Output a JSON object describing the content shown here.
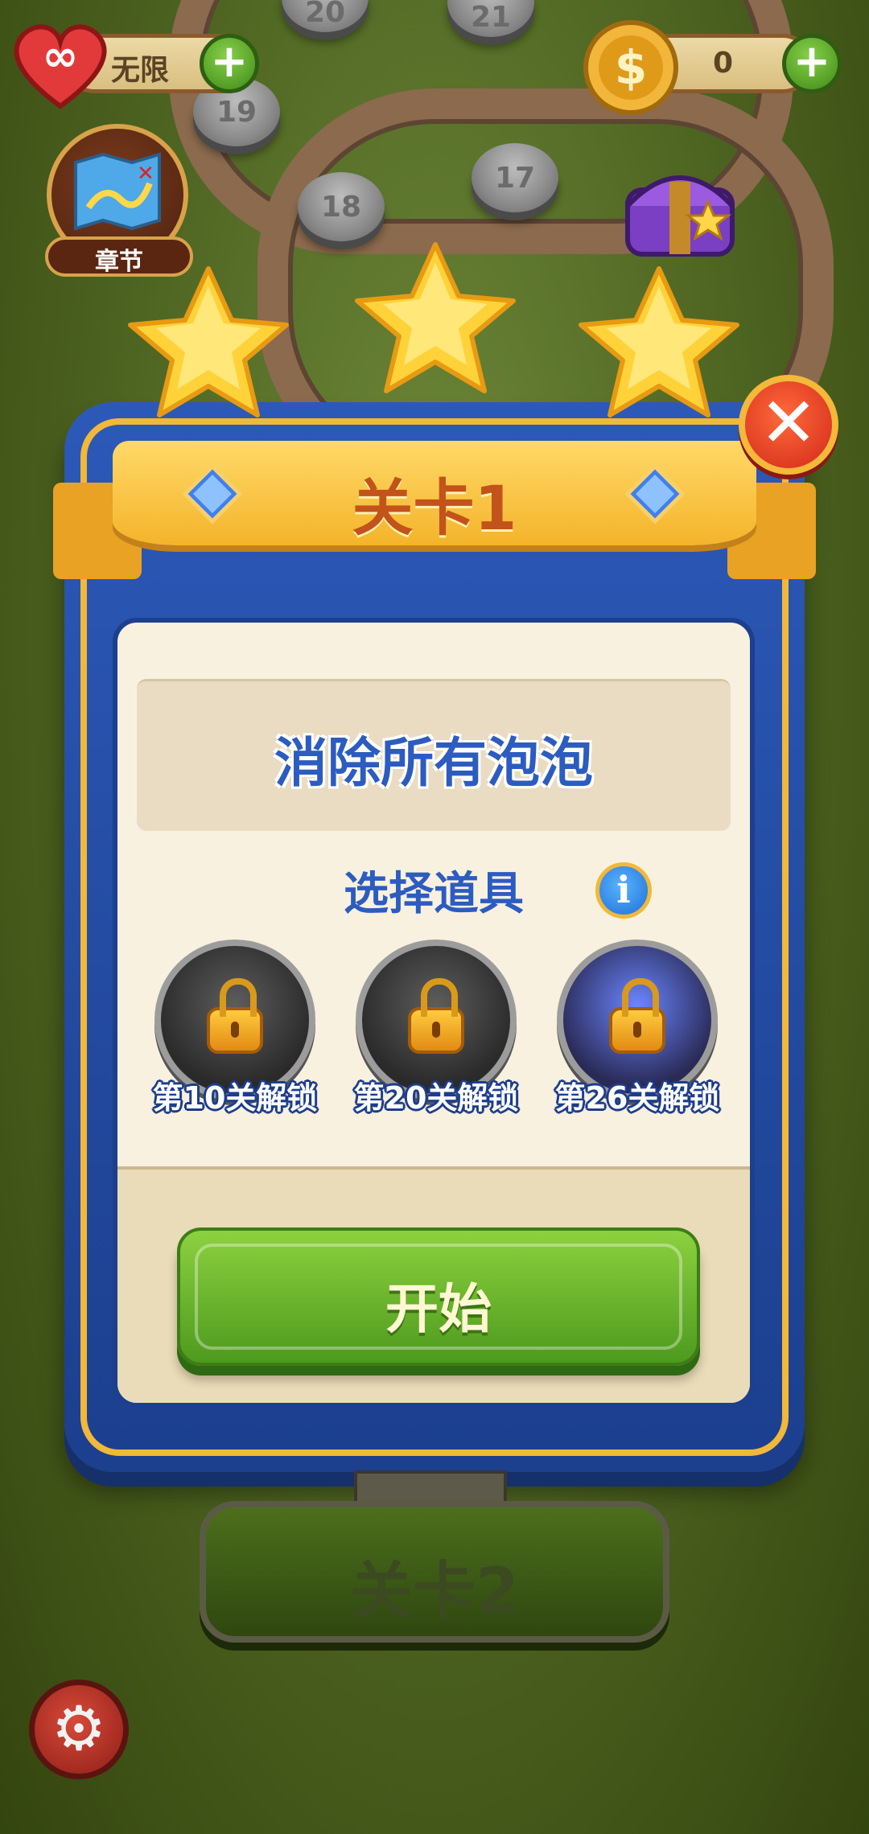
{
  "hud": {
    "lives_label": "无限",
    "coins_value": "0",
    "chapter_label": "章节"
  },
  "map": {
    "nodes": [
      "21",
      "20",
      "19",
      "18",
      "17"
    ]
  },
  "level_popup": {
    "title": "关卡1",
    "stars_earned": 3,
    "goal": "消除所有泡泡",
    "boosters_heading": "选择道具",
    "boosters": [
      {
        "unlock_label": "第10关解锁"
      },
      {
        "unlock_label": "第20关解锁"
      },
      {
        "unlock_label": "第26关解锁"
      }
    ],
    "start_label": "开始"
  },
  "next_level_label": "关卡2",
  "colors": {
    "panel_blue": "#2c59b8",
    "ribbon_gold": "#f4b42b",
    "start_green": "#6ab52c",
    "close_red": "#d2281a",
    "goal_text_blue": "#2d5cc0"
  }
}
